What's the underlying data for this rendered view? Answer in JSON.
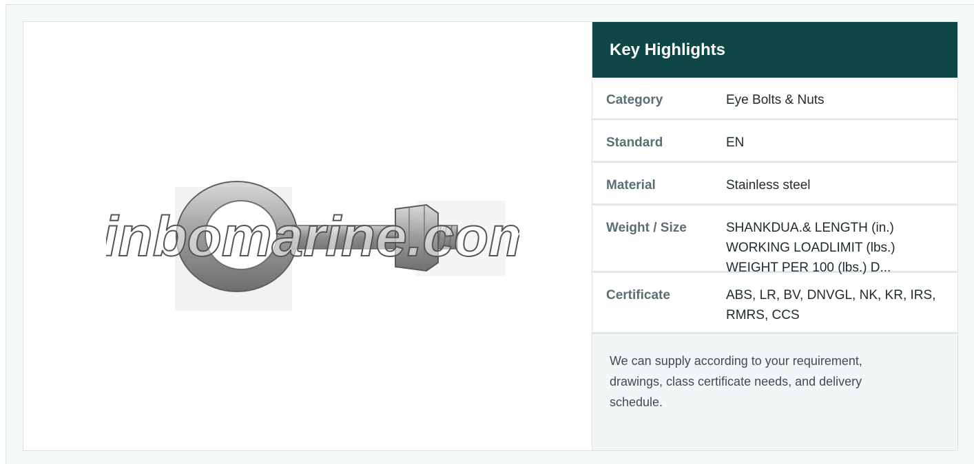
{
  "image": {
    "watermark": "jinbomarine.com"
  },
  "highlights": {
    "title": "Key Highlights",
    "rows": [
      {
        "label": "Category",
        "value": "Eye Bolts & Nuts"
      },
      {
        "label": "Standard",
        "value": "EN"
      },
      {
        "label": "Material",
        "value": "Stainless steel"
      },
      {
        "label": "Weight / Size",
        "value": "SHANKDUA.& LENGTH (in.) WORKING LOADLIMIT (lbs.) WEIGHT PER 100 (lbs.) D..."
      },
      {
        "label": "Certificate",
        "value": "ABS, LR, BV, DNVGL, NK, KR, IRS, RMRS, CCS"
      }
    ],
    "note": "We can supply according to your requirement, drawings, class certificate needs, and delivery schedule."
  },
  "colors": {
    "header_bg": "#0f4646",
    "label_color": "#5b6e74",
    "note_bg": "#f3f6f7"
  }
}
